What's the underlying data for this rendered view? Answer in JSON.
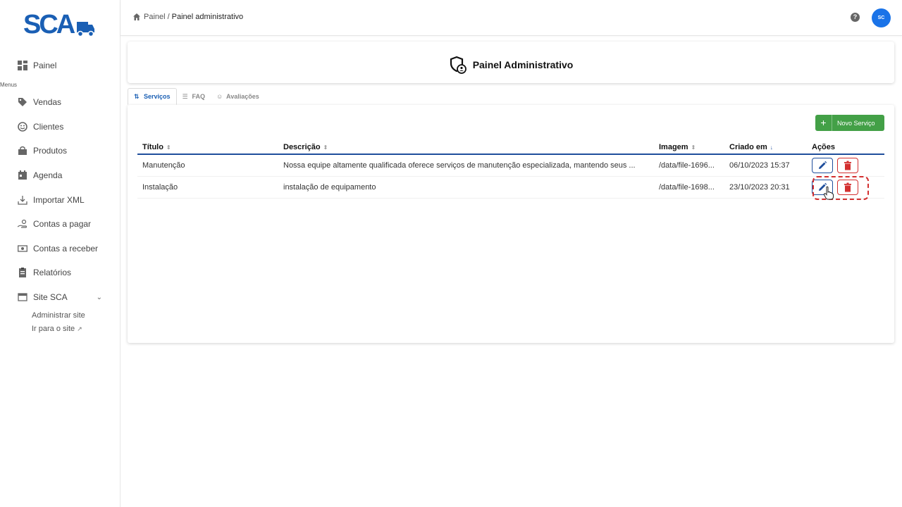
{
  "app": {
    "logo_text": "SCA"
  },
  "sidebar": {
    "top_item": {
      "label": "Painel",
      "icon": "dashboard-icon"
    },
    "menus_label": "Menus",
    "items": [
      {
        "label": "Vendas",
        "icon": "tag-icon"
      },
      {
        "label": "Clientes",
        "icon": "smiley-icon"
      },
      {
        "label": "Produtos",
        "icon": "shopping-bag-icon"
      },
      {
        "label": "Agenda",
        "icon": "calendar-icon"
      },
      {
        "label": "Importar XML",
        "icon": "download-icon"
      },
      {
        "label": "Contas a pagar",
        "icon": "hand-coin-icon"
      },
      {
        "label": "Contas a receber",
        "icon": "money-icon"
      },
      {
        "label": "Relatórios",
        "icon": "clipboard-icon"
      },
      {
        "label": "Site SCA",
        "icon": "browser-window-icon"
      }
    ],
    "site_sub": [
      {
        "label": "Administrar site"
      },
      {
        "label": "Ir para o site"
      }
    ]
  },
  "topbar": {
    "breadcrumb_home": "Painel",
    "breadcrumb_sep": "/",
    "breadcrumb_current": "Painel administrativo",
    "help": "?",
    "avatar_initials": "SC"
  },
  "header": {
    "title": "Painel Administrativo"
  },
  "tabs": [
    {
      "label": "Serviços",
      "active": true
    },
    {
      "label": "FAQ",
      "active": false
    },
    {
      "label": "Avaliações",
      "active": false
    }
  ],
  "toolbar": {
    "new_plus": "+",
    "new_label": "Novo Serviço"
  },
  "table": {
    "columns": [
      "Título",
      "Descrição",
      "Imagem",
      "Criado em",
      "Ações"
    ],
    "sort_icons": [
      "⇕",
      "⇕",
      "⇕",
      "↓"
    ],
    "rows": [
      {
        "titulo": "Manutenção",
        "descricao": "Nossa equipe altamente qualificada oferece serviços de manutenção especializada, mantendo seus ...",
        "imagem": "/data/file-1696...",
        "criado_em": "06/10/2023 15:37"
      },
      {
        "titulo": "Instalação",
        "descricao": "instalação de equipamento",
        "imagem": "/data/file-1698...",
        "criado_em": "23/10/2023 20:31"
      }
    ]
  },
  "colors": {
    "primary": "#1f4e9c",
    "success": "#43a047",
    "danger": "#d32f2f",
    "avatar": "#1a73e8"
  }
}
